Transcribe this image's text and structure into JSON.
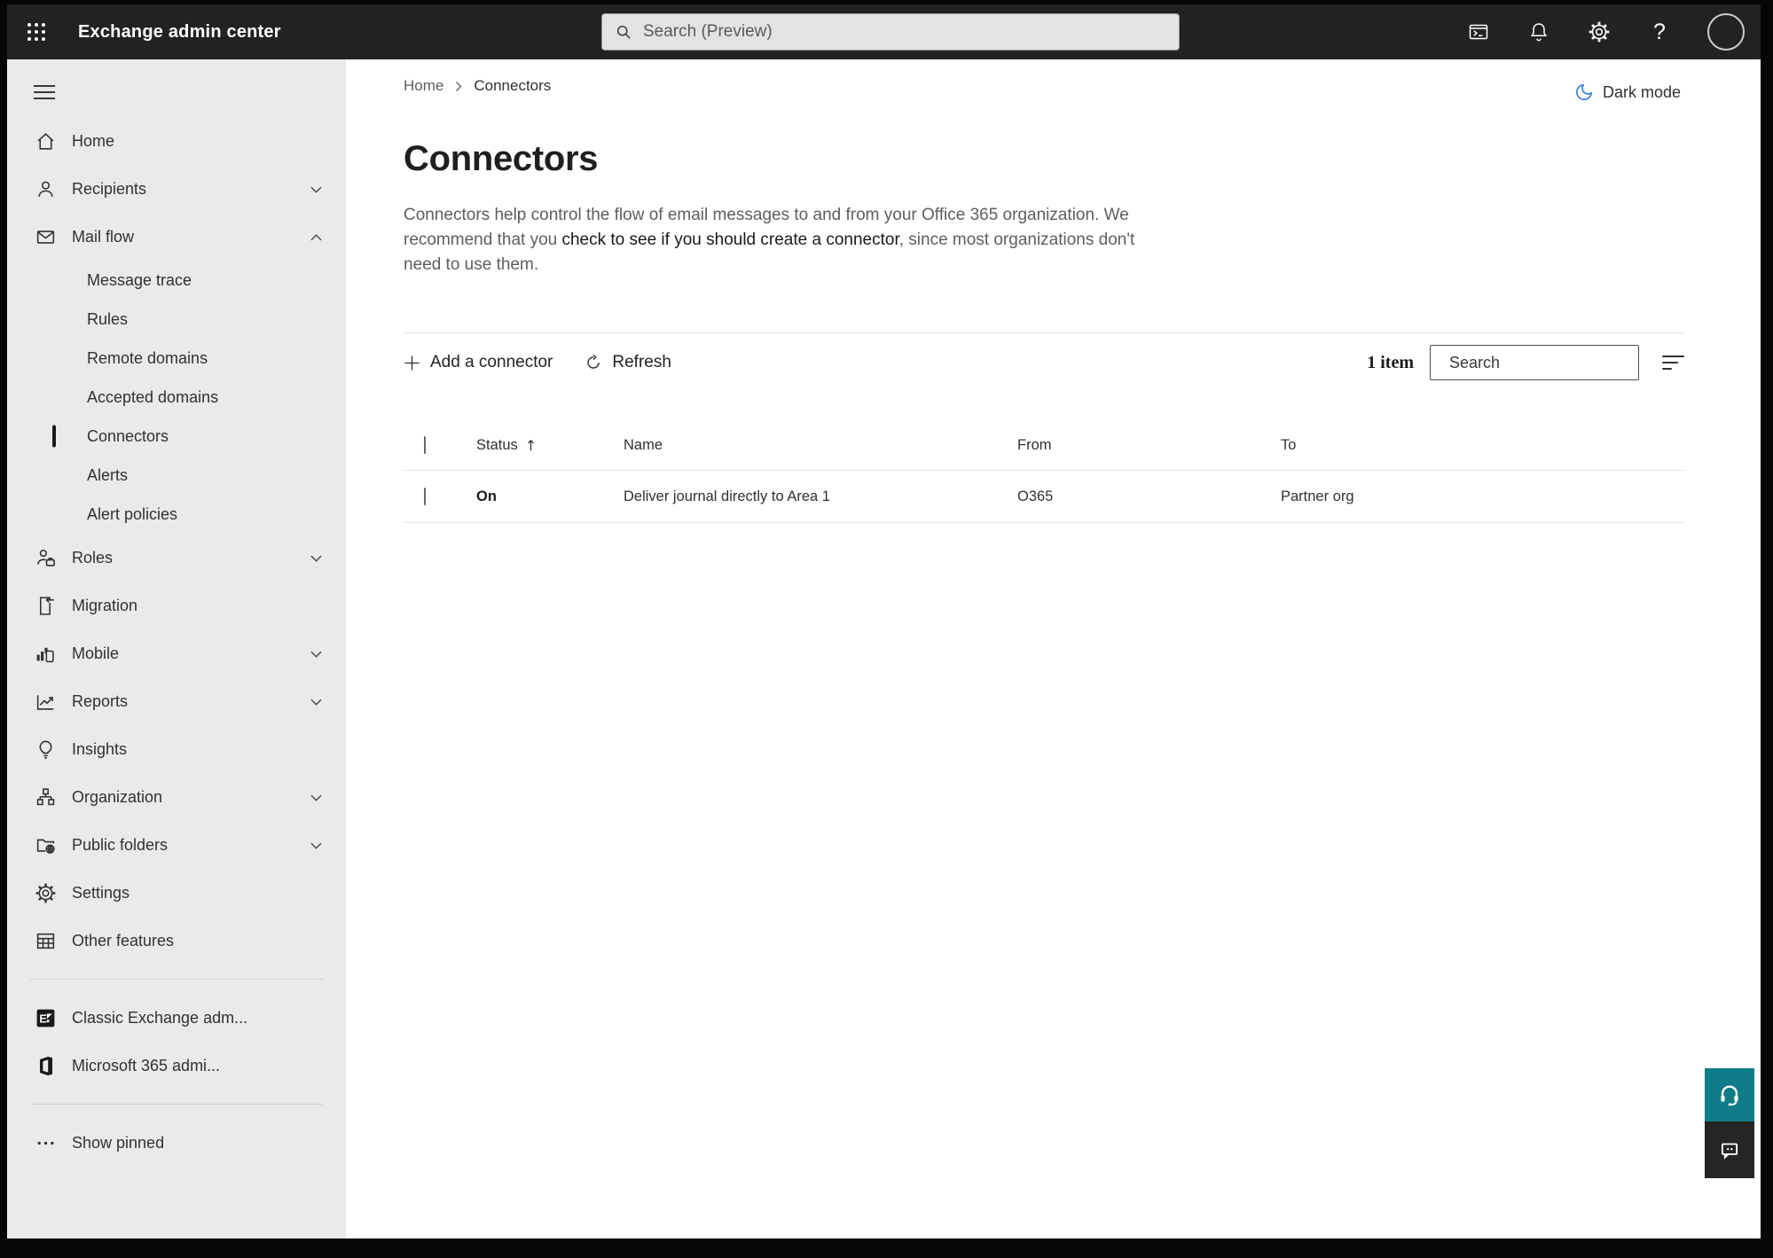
{
  "topbar": {
    "app_title": "Exchange admin center",
    "search_placeholder": "Search (Preview)",
    "icons": [
      "app-launcher",
      "powershell-console",
      "notifications-bell",
      "settings-gear",
      "help",
      "account-avatar"
    ],
    "help_glyph": "?"
  },
  "sidebar": {
    "items": [
      {
        "label": "Home",
        "type": "top"
      },
      {
        "label": "Recipients",
        "type": "top",
        "chevron": "down"
      },
      {
        "label": "Mail flow",
        "type": "top",
        "chevron": "up",
        "expanded": true
      },
      {
        "label": "Message trace",
        "type": "sub"
      },
      {
        "label": "Rules",
        "type": "sub"
      },
      {
        "label": "Remote domains",
        "type": "sub"
      },
      {
        "label": "Accepted domains",
        "type": "sub"
      },
      {
        "label": "Connectors",
        "type": "sub",
        "selected": true
      },
      {
        "label": "Alerts",
        "type": "sub"
      },
      {
        "label": "Alert policies",
        "type": "sub"
      },
      {
        "label": "Roles",
        "type": "top",
        "chevron": "down"
      },
      {
        "label": "Migration",
        "type": "top"
      },
      {
        "label": "Mobile",
        "type": "top",
        "chevron": "down"
      },
      {
        "label": "Reports",
        "type": "top",
        "chevron": "down"
      },
      {
        "label": "Insights",
        "type": "top"
      },
      {
        "label": "Organization",
        "type": "top",
        "chevron": "down"
      },
      {
        "label": "Public folders",
        "type": "top",
        "chevron": "down"
      },
      {
        "label": "Settings",
        "type": "top"
      },
      {
        "label": "Other features",
        "type": "top"
      },
      {
        "label": "Classic Exchange adm...",
        "type": "external-link"
      },
      {
        "label": "Microsoft 365 admi...",
        "type": "external-link"
      },
      {
        "label": "Show pinned",
        "type": "action"
      }
    ]
  },
  "breadcrumb": {
    "items": [
      {
        "label": "Home"
      },
      {
        "label": "Connectors"
      }
    ]
  },
  "dark_mode": {
    "label": "Dark mode"
  },
  "page": {
    "title": "Connectors",
    "description": {
      "pre": "Connectors help control the flow of email messages to and from your Office 365 organization. We recommend that you ",
      "link": "check to see if you should create a connector",
      "post": ", since most organizations don't need to use them."
    }
  },
  "toolbar": {
    "add_button": "Add a connector",
    "refresh_button": "Refresh",
    "item_count": "1 item",
    "search_placeholder": "Search"
  },
  "table": {
    "headers": {
      "status": "Status",
      "name": "Name",
      "from": "From",
      "to": "To"
    },
    "sort": {
      "column": "Status",
      "direction": "ascending",
      "indicator": "↑"
    },
    "rows": [
      {
        "status": "On",
        "name": "Deliver journal directly to Area 1",
        "from": "O365",
        "to": "Partner org"
      }
    ]
  },
  "floating_buttons": {
    "help": "support-headset",
    "feedback": "feedback-chat"
  },
  "colors": {
    "topbar_bg": "#232222",
    "sidebar_bg": "#ebeae9",
    "accent_blue": "#2b7cd8",
    "help_teal": "#0e7d87",
    "feedback_dark": "#262524"
  }
}
